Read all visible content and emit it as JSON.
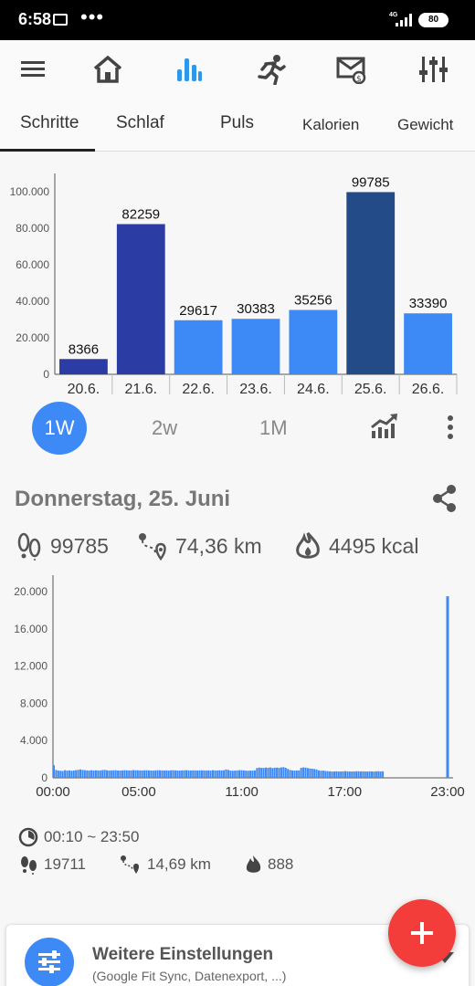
{
  "status_bar": {
    "time": "6:58",
    "network": "4G",
    "battery": "80",
    "icons": [
      "mail-icon",
      "more-dots-icon",
      "signal-icon",
      "battery-icon"
    ]
  },
  "nav": {
    "icons": [
      "menu-icon",
      "home-icon",
      "stats-icon",
      "running-icon",
      "mail-badge-icon",
      "sliders-icon"
    ],
    "active": "stats-icon",
    "active_color": "#2f96e8"
  },
  "tabs": [
    "Schritte",
    "Schlaf",
    "Puls",
    "Kalorien",
    "Gewicht"
  ],
  "active_tab": "Schritte",
  "range_buttons": {
    "active": "1W",
    "others": [
      "2w",
      "1M"
    ]
  },
  "chart_data": [
    {
      "type": "bar",
      "categories": [
        "20.6.",
        "21.6.",
        "22.6.",
        "23.6.",
        "24.6.",
        "25.6.",
        "26.6."
      ],
      "values": [
        8366,
        82259,
        29617,
        30383,
        35256,
        99785,
        33390
      ],
      "value_labels": [
        "8366",
        "82259",
        "29617",
        "30383",
        "35256",
        "99785",
        "33390"
      ],
      "y_ticks": [
        "0",
        "20.000",
        "40.000",
        "60.000",
        "80.000",
        "100.000"
      ],
      "ylim": [
        0,
        100000
      ],
      "bar_colors": [
        "#2b3da5",
        "#2b3da5",
        "#3d8af7",
        "#3d8af7",
        "#3d8af7",
        "#234b87",
        "#3d8af7"
      ],
      "grid": false
    },
    {
      "type": "bar",
      "x_ticks": [
        "00:00",
        "05:00",
        "11:00",
        "17:00",
        "23:00"
      ],
      "y_ticks": [
        "0",
        "4.000",
        "8.000",
        "12.000",
        "16.000",
        "20.000"
      ],
      "ylim": [
        0,
        20000
      ],
      "x_range_hours": [
        0,
        23
      ],
      "bar_color": "#3d8af7",
      "values": [
        1350,
        850,
        780,
        760,
        740,
        820,
        780,
        800,
        760,
        790,
        830,
        860,
        900,
        850,
        830,
        800,
        780,
        820,
        790,
        810,
        800,
        790,
        830,
        860,
        810,
        790,
        800,
        810,
        820,
        790,
        780,
        800,
        820,
        810,
        790,
        800,
        830,
        820,
        810,
        800,
        790,
        810,
        820,
        800,
        790,
        780,
        800,
        820,
        810,
        800,
        790,
        800,
        780,
        810,
        820,
        800,
        790,
        780,
        800,
        810,
        820,
        800,
        790,
        810,
        800,
        790,
        800,
        810,
        800,
        790,
        800,
        780,
        820,
        800,
        790,
        810,
        800,
        820,
        900,
        850,
        780,
        760,
        780,
        800,
        820,
        820,
        800,
        780,
        760,
        780,
        780,
        800,
        1050,
        1100,
        1080,
        1060,
        1100,
        1080,
        1120,
        1050,
        1090,
        1100,
        1080,
        1120,
        1150,
        1080,
        950,
        850,
        800,
        780,
        790,
        800,
        1080,
        1120,
        1100,
        1050,
        1000,
        980,
        950,
        900,
        800,
        760,
        780,
        740,
        720,
        700,
        680,
        690,
        700,
        680,
        690,
        700,
        720,
        700,
        690,
        680,
        690,
        700,
        710,
        690,
        700,
        690,
        680,
        700,
        690,
        680,
        700,
        710,
        690,
        700
      ],
      "spike": {
        "hour": 23,
        "value": 19500
      }
    }
  ],
  "day": {
    "title": "Donnerstag, 25. Juni",
    "steps": "99785",
    "distance": "74,36 km",
    "calories": "4495 kcal"
  },
  "summary": {
    "time_range": "00:10 ~ 23:50",
    "steps": "19711",
    "distance": "14,69 km",
    "calories": "888"
  },
  "card": {
    "title": "Weitere Einstellungen",
    "subtitle": "(Google Fit Sync, Datenexport, ...)"
  },
  "fab_label": "+",
  "colors": {
    "accent": "#3d8af7",
    "fab": "#f23d3a"
  }
}
